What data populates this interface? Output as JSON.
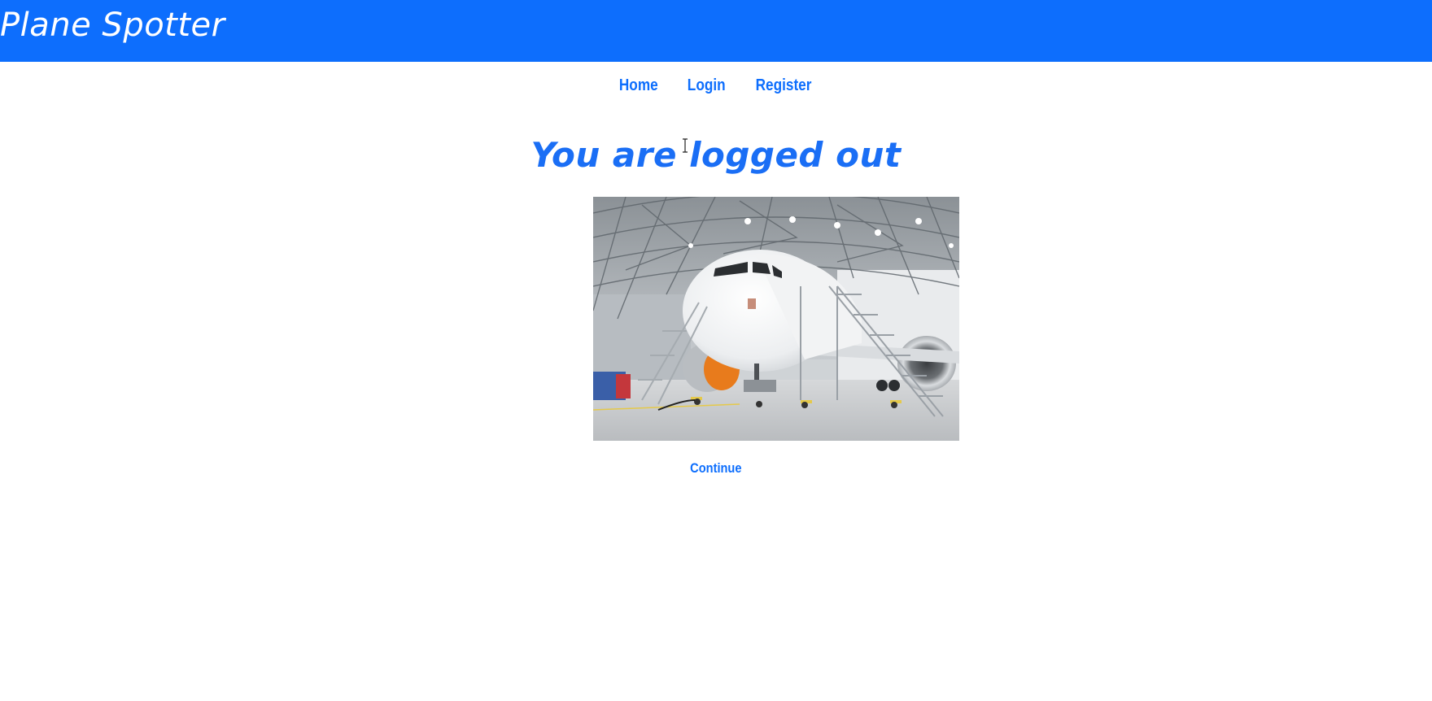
{
  "header": {
    "brand": "Plane Spotter",
    "background_color": "#0d6efd"
  },
  "nav": {
    "items": [
      {
        "label": "Home"
      },
      {
        "label": "Login"
      },
      {
        "label": "Register"
      }
    ],
    "link_color": "#0d6efd"
  },
  "main": {
    "heading": "You are logged out",
    "image": {
      "subject": "passenger jet airliner in a maintenance hangar",
      "icon": "airplane-hangar-photo"
    },
    "continue_label": "Continue"
  },
  "cursor": {
    "type": "text-ibeam"
  }
}
